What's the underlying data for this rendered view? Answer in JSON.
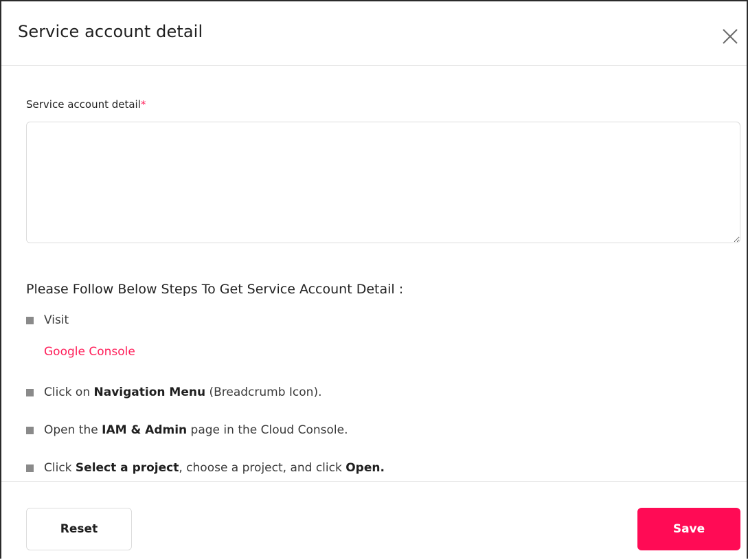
{
  "modal": {
    "title": "Service account detail"
  },
  "form": {
    "field_label": "Service account detail",
    "required_mark": "*",
    "textarea_value": ""
  },
  "instructions": {
    "heading": "Please Follow Below Steps To Get Service Account Detail :",
    "step1": "Visit",
    "link": "Google Console",
    "step2": {
      "pre": "Click on ",
      "bold": "Navigation Menu",
      "post": " (Breadcrumb Icon)."
    },
    "step3": {
      "pre": "Open the ",
      "bold": "IAM & Admin",
      "post": " page in the Cloud Console."
    },
    "step4": {
      "pre": "Click ",
      "bold": "Select a project",
      "mid": ", choose a project, and click ",
      "bold2": "Open."
    }
  },
  "footer": {
    "reset_label": "Reset",
    "save_label": "Save"
  },
  "colors": {
    "accent": "#ff0b55",
    "link": "#ff1f5a",
    "bullet": "#8a8a8a"
  },
  "icons": {
    "close": "close-icon"
  }
}
